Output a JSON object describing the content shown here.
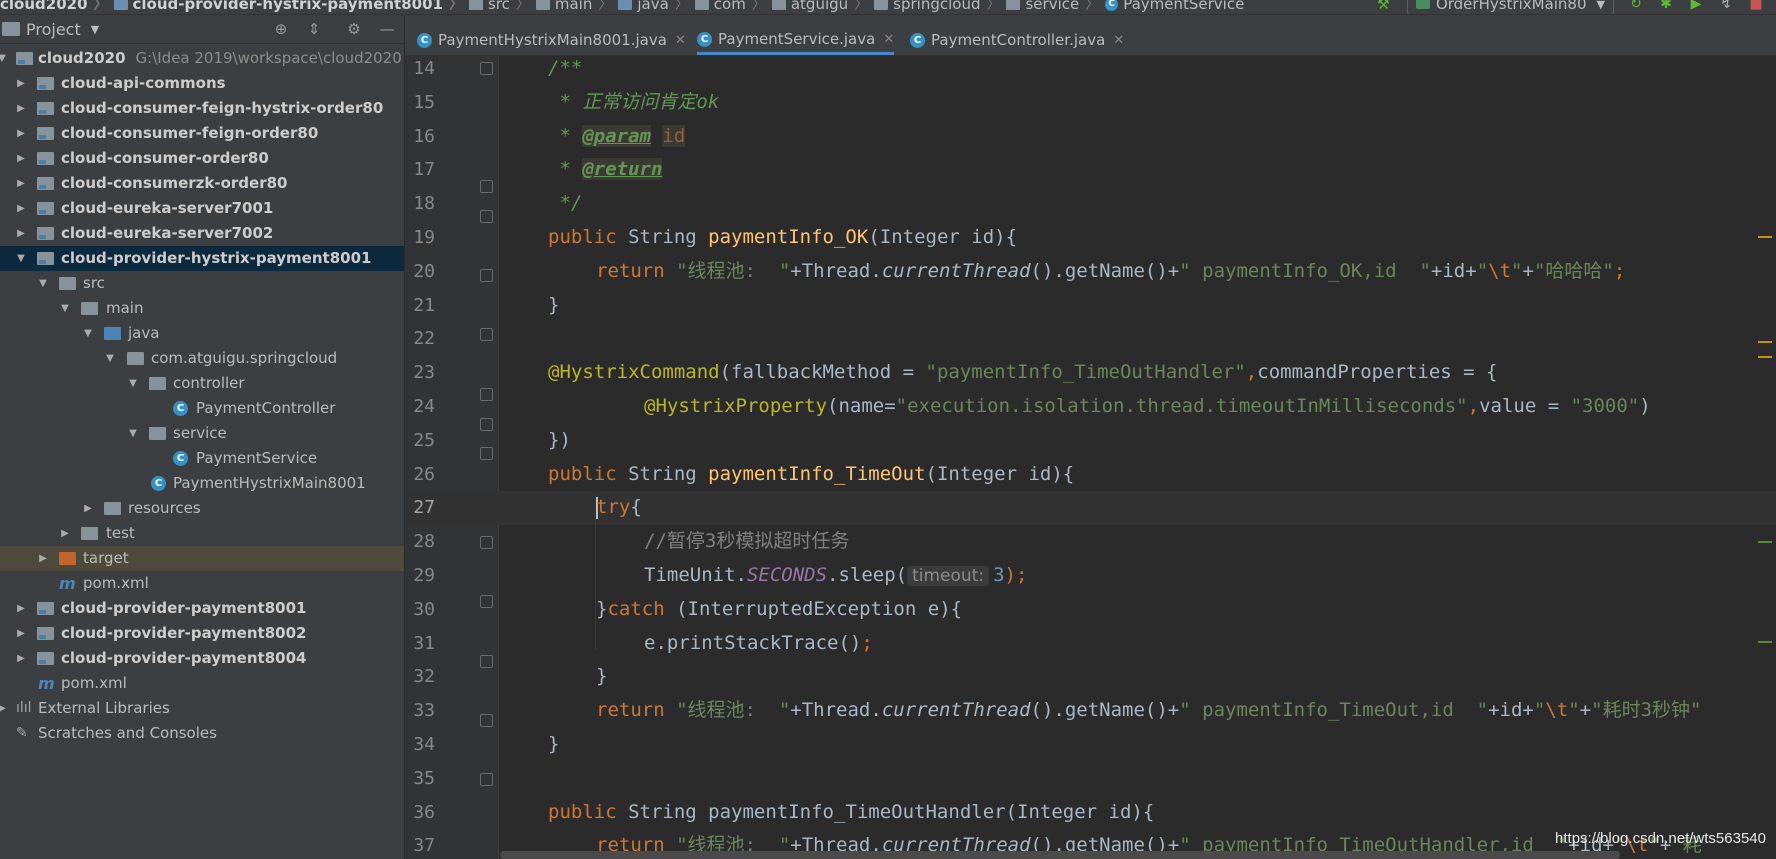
{
  "navbar": {
    "crumbs": [
      "cloud2020",
      "cloud-provider-hystrix-payment8001",
      "src",
      "main",
      "java",
      "com",
      "atguigu",
      "springcloud",
      "service",
      "PaymentService"
    ],
    "run_config": "OrderHystrixMain80"
  },
  "project_panel": {
    "title": "Project",
    "tree": [
      {
        "label": "cloud2020",
        "path": "G:\\Idea 2019\\workspace\\cloud2020"
      },
      {
        "label": "cloud-api-commons"
      },
      {
        "label": "cloud-consumer-feign-hystrix-order80"
      },
      {
        "label": "cloud-consumer-feign-order80"
      },
      {
        "label": "cloud-consumer-order80"
      },
      {
        "label": "cloud-consumerzk-order80"
      },
      {
        "label": "cloud-eureka-server7001"
      },
      {
        "label": "cloud-eureka-server7002"
      },
      {
        "label": "cloud-provider-hystrix-payment8001"
      },
      {
        "label": "src"
      },
      {
        "label": "main"
      },
      {
        "label": "java"
      },
      {
        "label": "com.atguigu.springcloud"
      },
      {
        "label": "controller"
      },
      {
        "label": "PaymentController"
      },
      {
        "label": "service"
      },
      {
        "label": "PaymentService"
      },
      {
        "label": "PaymentHystrixMain8001"
      },
      {
        "label": "resources"
      },
      {
        "label": "test"
      },
      {
        "label": "target"
      },
      {
        "label": "pom.xml"
      },
      {
        "label": "cloud-provider-payment8001"
      },
      {
        "label": "cloud-provider-payment8002"
      },
      {
        "label": "cloud-provider-payment8004"
      },
      {
        "label": "pom.xml"
      },
      {
        "label": "External Libraries"
      },
      {
        "label": "Scratches and Consoles"
      }
    ]
  },
  "tabs": [
    "PaymentHystrixMain8001.java",
    "PaymentService.java",
    "PaymentController.java"
  ],
  "editor": {
    "line_numbers": [
      "14",
      "15",
      "16",
      "17",
      "18",
      "19",
      "20",
      "21",
      "22",
      "23",
      "24",
      "25",
      "26",
      "27",
      "28",
      "29",
      "30",
      "31",
      "32",
      "33",
      "34",
      "35",
      "36",
      "37"
    ],
    "code": {
      "l14": "/**",
      "l15_star": " * ",
      "l15_text": "正常访问肯定ok",
      "l16_star": " * ",
      "l16_tag": "@param",
      "l16_param": "id",
      "l17_star": " * ",
      "l17_tag": "@return",
      "l18": " */",
      "kw_public": "public",
      "type_string": " String ",
      "fn_ok": "paymentInfo_OK",
      "params_int": "(Integer id){",
      "kw_return": "return",
      "s_pool": "\"线程池:  \"",
      "thread_pre": "+Thread.",
      "current_thread": "currentThread",
      "get_name": "().getName()+",
      "s_ok": "\" paymentInfo_OK,id  \"",
      "plus_id": "+id+",
      "q_open": "\"",
      "esc_t": "\\t",
      "q_close": "\"",
      "plus": "+",
      "s_hahaha": "\"哈哈哈\"",
      "semi": ";",
      "brace_close": "}",
      "ann_cmd": "@HystrixCommand",
      "fallback_key": "(fallbackMethod = ",
      "fallback_val": "\"paymentInfo_TimeOutHandler\"",
      "comma": ",",
      "cmd_props": "commandProperties = {",
      "ann_prop": "@HystrixProperty",
      "name_key": "(name=",
      "name_val": "\"execution.isolation.thread.timeoutInMilliseconds\"",
      "value_key": "value = ",
      "value_val": "\"3000\"",
      "paren_close": ")",
      "brace_paren_close": "})",
      "fn_timeout": "paymentInfo_TimeOut",
      "kw_try": "try",
      "brace_open": "{",
      "cmt_pause": "//暂停3秒模拟超时任务",
      "timeunit": "TimeUnit.",
      "seconds": "SECONDS",
      "sleep": ".sleep(",
      "hint_timeout": "timeout:",
      "num3": "3",
      "paren_semi": ");",
      "catch_pre": "}",
      "kw_catch": "catch",
      "catch_args": " (InterruptedException e){",
      "print_trace": "e.printStackTrace()",
      "s_timeout_id": "\" paymentInfo_TimeOut,id  \"",
      "s_cost3": "\"耗时3秒钟\"",
      "fn_handler": "paymentInfo_TimeOutHandler",
      "s_handler_id": "\" paymentInfo_TimeOutHandler,id  \"",
      "l37_tail_plus": "+",
      "s_partial": "\"耗"
    }
  },
  "watermark": "https://blog.csdn.net/wts563540"
}
